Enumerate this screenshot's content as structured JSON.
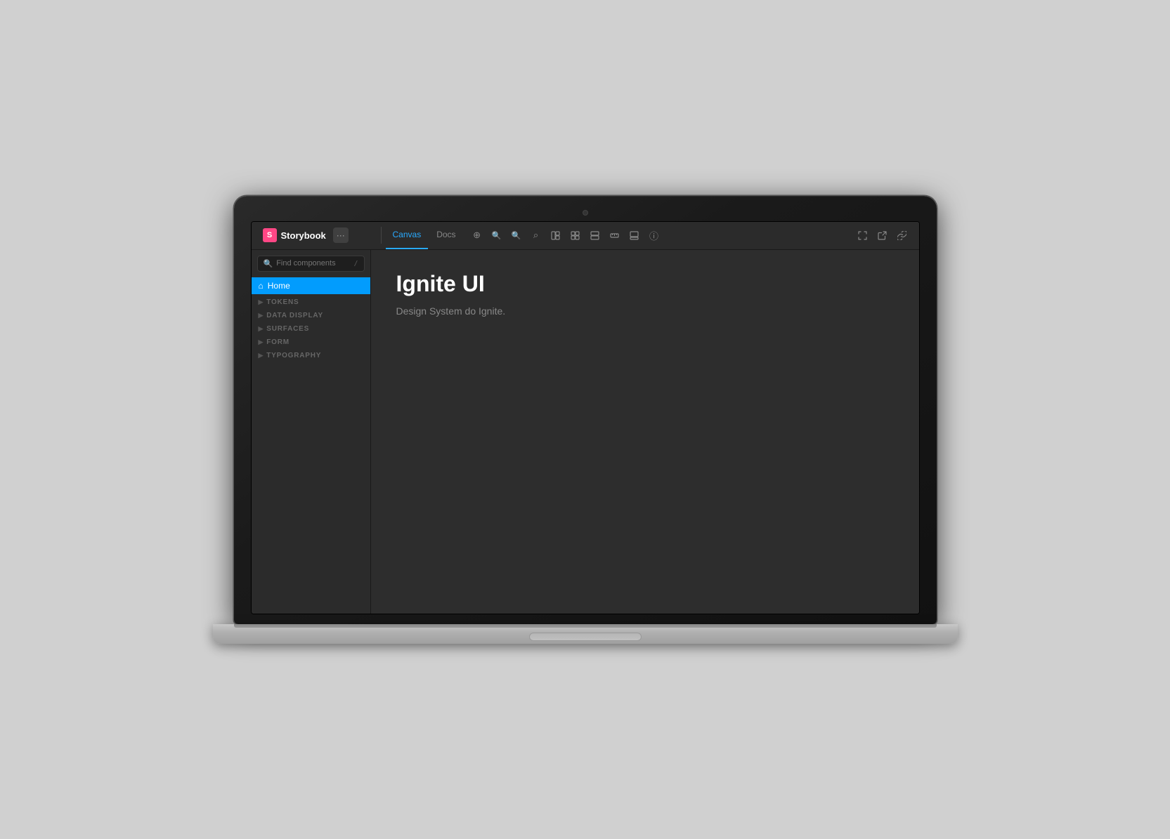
{
  "header": {
    "brand": {
      "logo_letter": "S",
      "name": "Storybook"
    },
    "menu_btn_label": "···",
    "tabs": [
      {
        "id": "canvas",
        "label": "Canvas",
        "active": true
      },
      {
        "id": "docs",
        "label": "Docs",
        "active": false
      }
    ],
    "toolbar_icons": [
      {
        "name": "reset-zoom-icon",
        "glyph": "⊕"
      },
      {
        "name": "zoom-in-icon",
        "glyph": "🔍"
      },
      {
        "name": "zoom-out-icon",
        "glyph": "🔍"
      },
      {
        "name": "search-canvas-icon",
        "glyph": "⌕"
      },
      {
        "name": "layout-icon",
        "glyph": "⊞"
      },
      {
        "name": "grid-icon",
        "glyph": "⊟"
      },
      {
        "name": "split-icon",
        "glyph": "⊟"
      },
      {
        "name": "ruler-icon",
        "glyph": "⊟"
      },
      {
        "name": "panel-icon",
        "glyph": "⊟"
      },
      {
        "name": "info-icon",
        "glyph": "ⓘ"
      }
    ],
    "right_icons": [
      {
        "name": "fullscreen-icon",
        "glyph": "⛶"
      },
      {
        "name": "open-new-icon",
        "glyph": "⧉"
      },
      {
        "name": "link-icon",
        "glyph": "🔗"
      }
    ]
  },
  "sidebar": {
    "search": {
      "placeholder": "Find components",
      "shortcut": "/"
    },
    "nav": {
      "home": {
        "label": "Home",
        "icon": "⌂"
      },
      "sections": [
        {
          "id": "tokens",
          "label": "TOKENS"
        },
        {
          "id": "data-display",
          "label": "DATA DISPLAY"
        },
        {
          "id": "surfaces",
          "label": "SURFACES"
        },
        {
          "id": "form",
          "label": "FORM"
        },
        {
          "id": "typography",
          "label": "TYPOGRAPHY"
        }
      ]
    }
  },
  "canvas": {
    "title": "Ignite UI",
    "subtitle": "Design System do Ignite."
  },
  "colors": {
    "accent": "#029cfd",
    "active_tab": "#29aaff",
    "brand": "#ff4785",
    "bg_main": "#2b2b2b",
    "bg_canvas": "#2d2d2d",
    "sidebar_bg": "#2b2b2b",
    "home_bg": "#029cfd"
  }
}
